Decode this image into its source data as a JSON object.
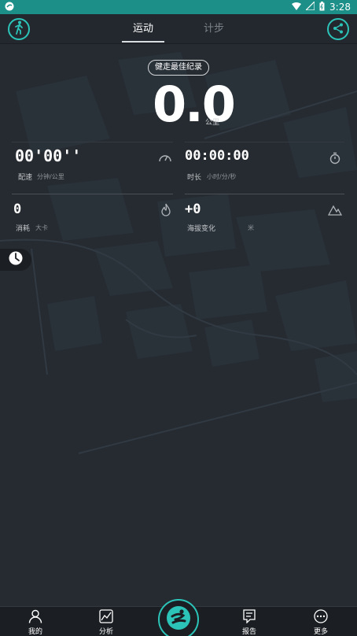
{
  "status_bar": {
    "time": "3:28"
  },
  "header": {
    "tabs": [
      {
        "label": "运动"
      },
      {
        "label": "计步"
      }
    ]
  },
  "record": {
    "best_label": "健走最佳纪录",
    "distance": "0.0",
    "distance_unit": "公里"
  },
  "stats": {
    "pace": {
      "value": "00'00''",
      "label": "配速",
      "unit": "分钟/公里"
    },
    "duration": {
      "value": "00:00:00",
      "label": "时长",
      "unit": "小时/分/秒"
    },
    "calories": {
      "value": "0",
      "label": "消耗",
      "unit": "大卡"
    },
    "altitude": {
      "value": "+0",
      "label": "海拔变化",
      "unit": "米"
    }
  },
  "bottom_nav": {
    "items": [
      {
        "label": "我的",
        "icon": "person-icon"
      },
      {
        "label": "分析",
        "icon": "chart-icon"
      },
      {
        "label": "报告",
        "icon": "report-icon"
      },
      {
        "label": "更多",
        "icon": "more-icon"
      }
    ],
    "center_icon": "runner-logo-icon"
  },
  "colors": {
    "accent": "#2cc4b8",
    "status_bar": "#1b8f88",
    "background": "#262b31"
  }
}
